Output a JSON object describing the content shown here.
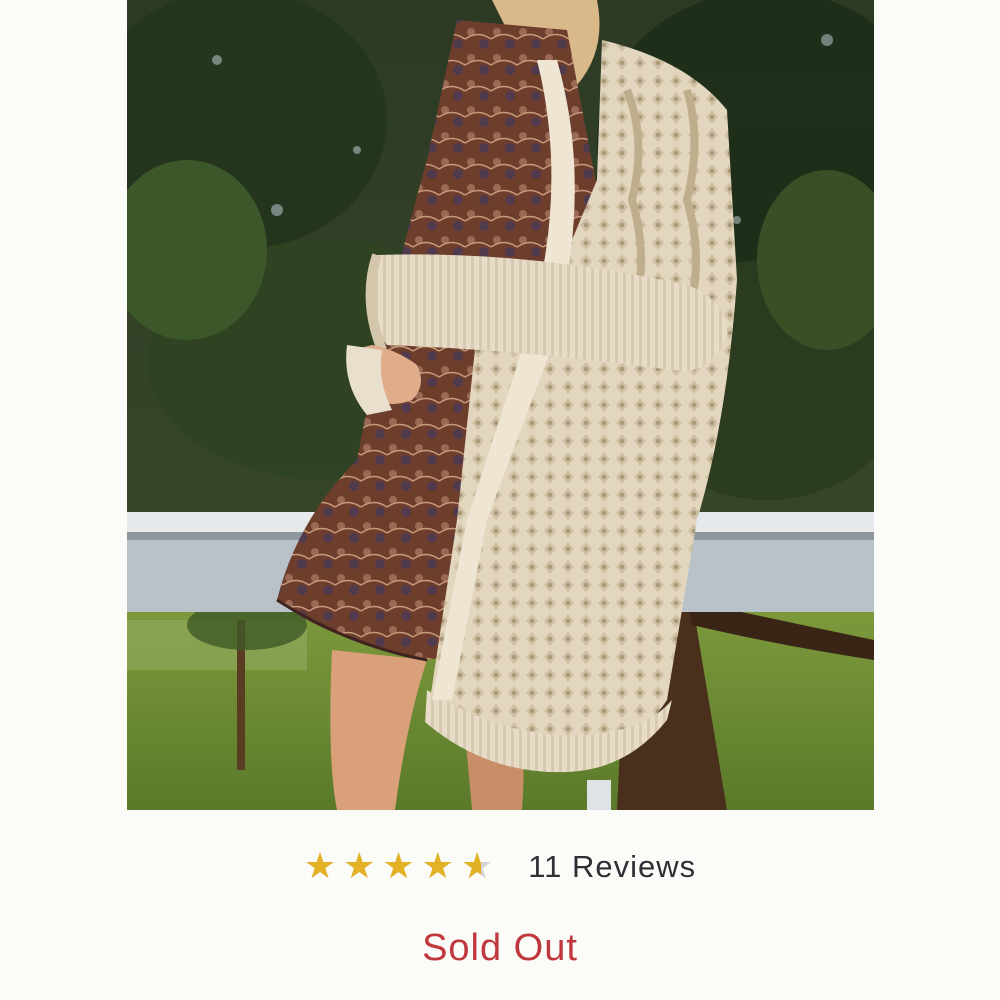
{
  "product": {
    "image_alt": "Model wearing cream cable-knit open-front cardigan over a paisley print dress, outdoors by a railing",
    "rating": {
      "value": 4.5,
      "max": 5,
      "stars_glyphs": "★★★★★"
    },
    "reviews_label": "11 Reviews",
    "availability_label": "Sold Out"
  },
  "colors": {
    "star_filled": "#e3b126",
    "star_empty": "#d3d3d3",
    "sold_out": "#c0383d",
    "text": "#2f2f36"
  }
}
